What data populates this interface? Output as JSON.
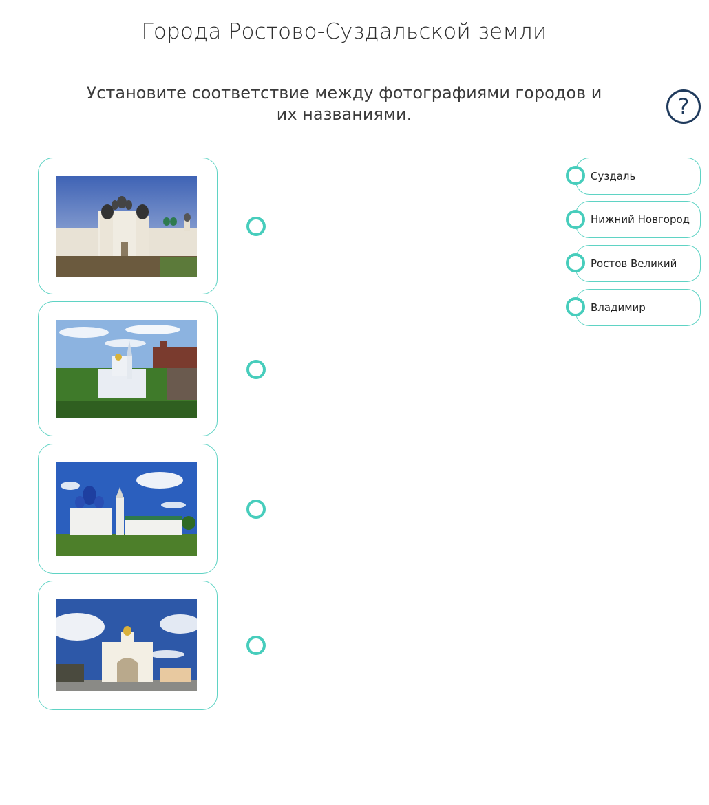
{
  "header": {
    "title": "Города Ростово-Суздальской земли",
    "instructions": "Установите соответствие между фотографиями городов и их названиями.",
    "help_symbol": "?"
  },
  "colors": {
    "accent": "#47cdbc",
    "card_border": "#5fd3c4",
    "help": "#1f3a5c"
  },
  "photos": [
    {
      "icon": "rostov-kremlin-photo"
    },
    {
      "icon": "nizhny-novgorod-church-photo"
    },
    {
      "icon": "suzdal-cathedral-photo"
    },
    {
      "icon": "vladimir-golden-gate-photo"
    }
  ],
  "answers": [
    {
      "label": "Суздаль"
    },
    {
      "label": "Нижний Новгород"
    },
    {
      "label": "Ростов Великий"
    },
    {
      "label": "Владимир"
    }
  ]
}
